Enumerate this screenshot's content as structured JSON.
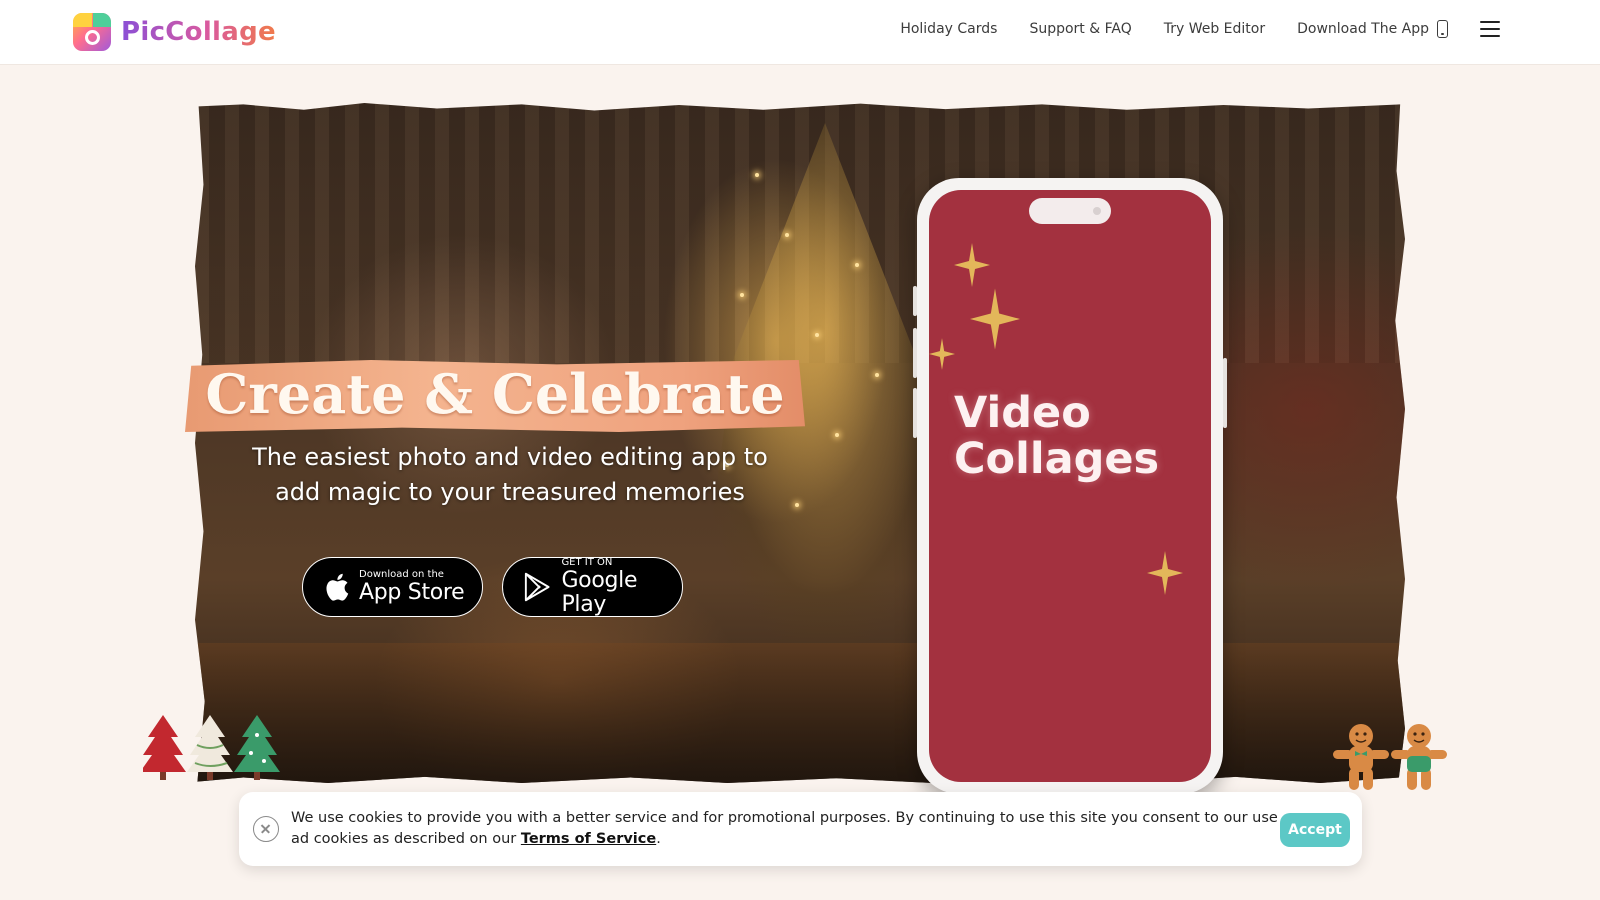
{
  "brand": {
    "name": "PicCollage"
  },
  "nav": {
    "items": [
      "Holiday Cards",
      "Support & FAQ",
      "Try Web Editor",
      "Download The App"
    ],
    "download_icon": "phone-icon",
    "menu_icon": "hamburger-menu-icon"
  },
  "hero": {
    "headline": "Create & Celebrate",
    "subline_1": "The easiest photo and video editing app to",
    "subline_2": "add magic to your treasured memories",
    "app_store": {
      "small": "Download on the",
      "big": "App Store",
      "icon": "apple-icon"
    },
    "google_play": {
      "small": "GET IT ON",
      "big": "Google Play",
      "icon": "google-play-icon"
    },
    "phone_screen_title_1": "Video",
    "phone_screen_title_2": "Collages"
  },
  "cookie": {
    "text": "We use cookies to provide you with a better service and for promotional purposes. By continuing to use this site you consent to our use ad cookies as described on our ",
    "link": "Terms of Service",
    "end": ".",
    "accept": "Accept",
    "close_icon": "close-circle-icon"
  },
  "colors": {
    "page_bg": "#faf3ee",
    "phone_screen": "#a3313f",
    "banner": "#f4b48f",
    "accept_button": "#5cc8c6"
  }
}
